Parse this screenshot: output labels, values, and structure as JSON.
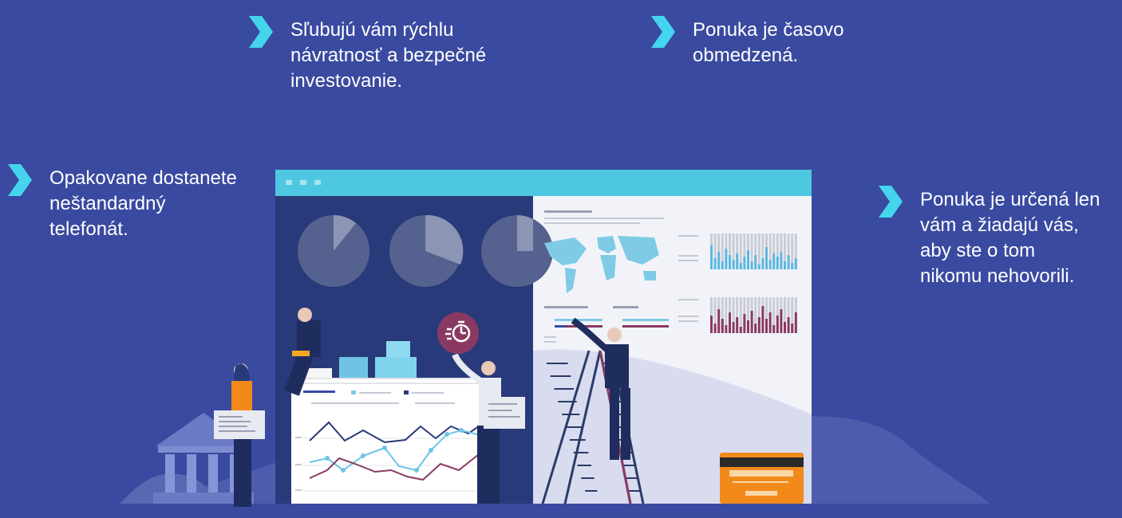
{
  "bullets": [
    {
      "text": "Sľubujú vám rýchlu\nnávratnosť a bezpečné\ninvestovanie."
    },
    {
      "text": "Ponuka je časovo\nobmedzená."
    },
    {
      "text": "Opakovane dostanete\nneštandardný\ntelefonát."
    },
    {
      "text": "Ponuka je určená len\nvám a žiadajú vás,\naby ste o tom\nnikomu nehovorili."
    }
  ],
  "colors": {
    "background": "#3a4aa0",
    "accent_cyan": "#4dc8e0",
    "chevron": "#44d4ee",
    "dashboard_dark": "#283a7a",
    "maroon": "#8a3a62",
    "orange": "#f28a1a"
  },
  "icons": {
    "bullet": "chevron-right-icon",
    "badge": "stopwatch-icon"
  }
}
